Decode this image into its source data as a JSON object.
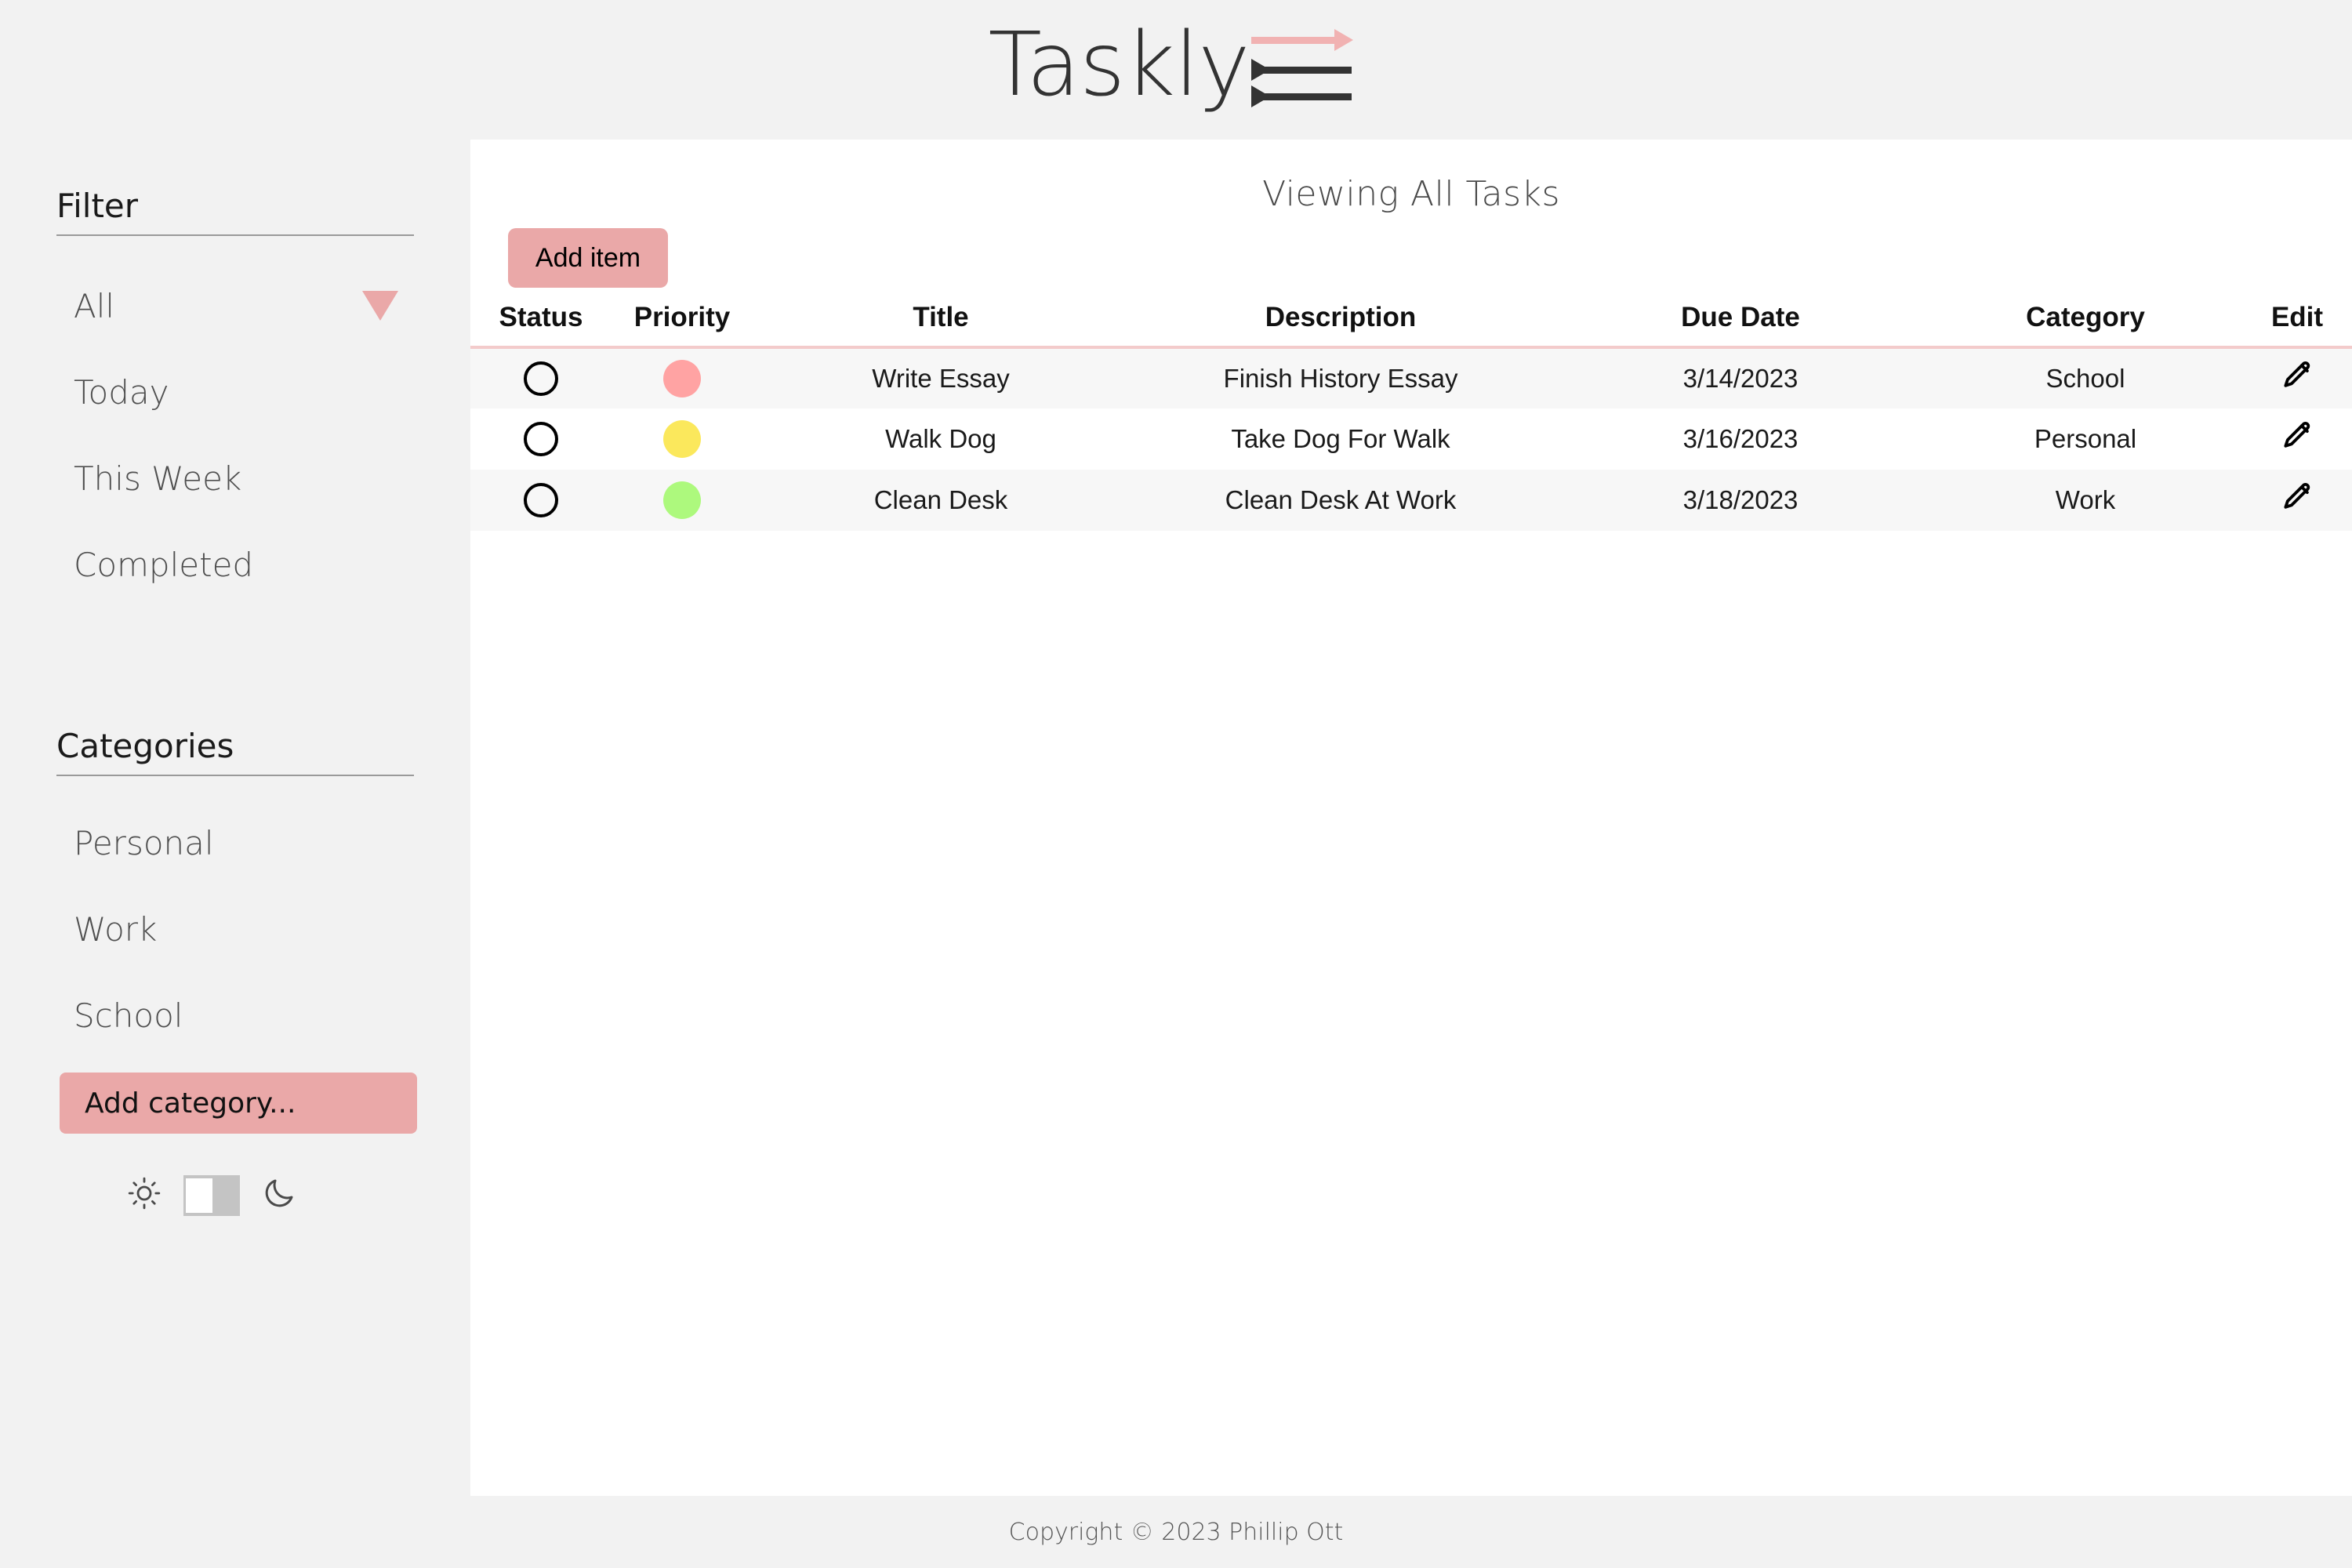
{
  "app": {
    "logo_text": "Taskly",
    "accent_color": "#eaa8a8",
    "accent_light": "#f1b2b2",
    "page_bg": "#f2f2f2",
    "panel_bg": "#ffffff"
  },
  "sidebar": {
    "filter": {
      "heading": "Filter",
      "items": [
        {
          "label": "All",
          "active": true
        },
        {
          "label": "Today",
          "active": false
        },
        {
          "label": "This Week",
          "active": false
        },
        {
          "label": "Completed",
          "active": false
        }
      ]
    },
    "categories": {
      "heading": "Categories",
      "items": [
        {
          "label": "Personal"
        },
        {
          "label": "Work"
        },
        {
          "label": "School"
        }
      ],
      "add_placeholder": "Add category..."
    },
    "theme": {
      "light_icon": "sun-icon",
      "dark_icon": "moon-icon",
      "state": "light"
    }
  },
  "main": {
    "title": "Viewing All Tasks",
    "add_item_label": "Add item",
    "columns": [
      "Status",
      "Priority",
      "Title",
      "Description",
      "Due Date",
      "Category",
      "Edit"
    ],
    "rows": [
      {
        "status": "unchecked",
        "priority_color": "#ffa3a3",
        "title": "Write Essay",
        "description": "Finish History Essay",
        "due_date": "3/14/2023",
        "category": "School",
        "edit_icon": "pencil-icon"
      },
      {
        "status": "unchecked",
        "priority_color": "#fbe85c",
        "title": "Walk Dog",
        "description": "Take Dog For Walk",
        "due_date": "3/16/2023",
        "category": "Personal",
        "edit_icon": "pencil-icon"
      },
      {
        "status": "unchecked",
        "priority_color": "#adf97d",
        "title": "Clean Desk",
        "description": "Clean Desk At Work",
        "due_date": "3/18/2023",
        "category": "Work",
        "edit_icon": "pencil-icon"
      }
    ]
  },
  "footer": {
    "copyright": "Copyright © 2023 Phillip Ott"
  }
}
